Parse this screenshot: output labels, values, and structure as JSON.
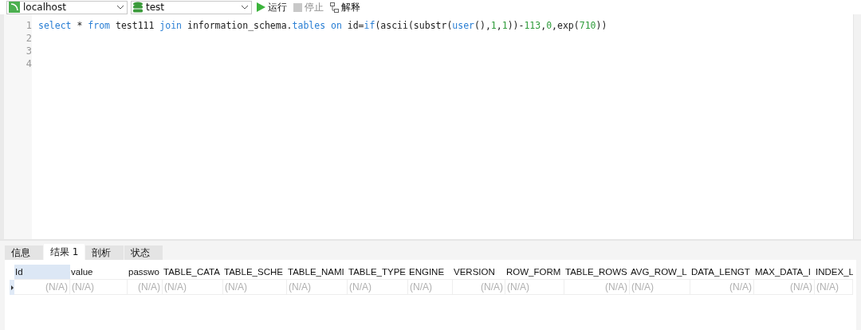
{
  "toolbar": {
    "connection": "localhost",
    "database": "test",
    "run": "运行",
    "stop": "停止",
    "explain": "解释"
  },
  "editor": {
    "lines": [
      {
        "number": "1",
        "tokens": [
          {
            "kind": "keyword",
            "text": "select"
          },
          {
            "kind": "plain",
            "text": " * "
          },
          {
            "kind": "keyword",
            "text": "from"
          },
          {
            "kind": "plain",
            "text": " test111 "
          },
          {
            "kind": "keyword",
            "text": "join"
          },
          {
            "kind": "plain",
            "text": " information_schema."
          },
          {
            "kind": "keyword",
            "text": "tables on"
          },
          {
            "kind": "plain",
            "text": " id="
          },
          {
            "kind": "keyword",
            "text": "if"
          },
          {
            "kind": "plain",
            "text": "(ascii(substr("
          },
          {
            "kind": "keyword",
            "text": "user"
          },
          {
            "kind": "plain",
            "text": "(),"
          },
          {
            "kind": "number",
            "text": "1"
          },
          {
            "kind": "plain",
            "text": ","
          },
          {
            "kind": "number",
            "text": "1"
          },
          {
            "kind": "plain",
            "text": "))-"
          },
          {
            "kind": "number",
            "text": "113"
          },
          {
            "kind": "plain",
            "text": ","
          },
          {
            "kind": "number",
            "text": "0"
          },
          {
            "kind": "plain",
            "text": ",exp("
          },
          {
            "kind": "number",
            "text": "710"
          },
          {
            "kind": "plain",
            "text": "))"
          }
        ]
      },
      {
        "number": "2"
      },
      {
        "number": "3"
      },
      {
        "number": "4"
      }
    ]
  },
  "result_tabs": [
    {
      "label": "信息",
      "selected": false
    },
    {
      "label": "结果 1",
      "selected": true
    },
    {
      "label": "剖析",
      "selected": false
    },
    {
      "label": "状态",
      "selected": false
    }
  ],
  "grid": {
    "columns": [
      {
        "label": "Id",
        "kind": "numeric",
        "selected": true
      },
      {
        "label": "value",
        "kind": "text",
        "selected": false
      },
      {
        "label": "passwo",
        "kind": "numeric",
        "selected": false
      },
      {
        "label": "TABLE_CATA",
        "kind": "text",
        "selected": false
      },
      {
        "label": "TABLE_SCHE",
        "kind": "text",
        "selected": false
      },
      {
        "label": "TABLE_NAMI",
        "kind": "text",
        "selected": false
      },
      {
        "label": "TABLE_TYPE",
        "kind": "text",
        "selected": false
      },
      {
        "label": "ENGINE",
        "kind": "text",
        "selected": false
      },
      {
        "label": "VERSION",
        "kind": "numeric",
        "selected": false
      },
      {
        "label": "ROW_FORM",
        "kind": "text",
        "selected": false
      },
      {
        "label": "TABLE_ROWS",
        "kind": "numeric",
        "selected": false
      },
      {
        "label": "AVG_ROW_L",
        "kind": "text",
        "selected": false
      },
      {
        "label": "DATA_LENGT",
        "kind": "numeric",
        "selected": false
      },
      {
        "label": "MAX_DATA_I",
        "kind": "numeric",
        "selected": false
      },
      {
        "label": "INDEX_L",
        "kind": "text",
        "selected": false
      }
    ],
    "rows": [
      [
        "(N/A)",
        "(N/A)",
        "(N/A)",
        "(N/A)",
        "(N/A)",
        "(N/A)",
        "(N/A)",
        "(N/A)",
        "(N/A)",
        "(N/A)",
        "(N/A)",
        "(N/A)",
        "(N/A)",
        "(N/A)",
        "(N/A)"
      ]
    ]
  }
}
